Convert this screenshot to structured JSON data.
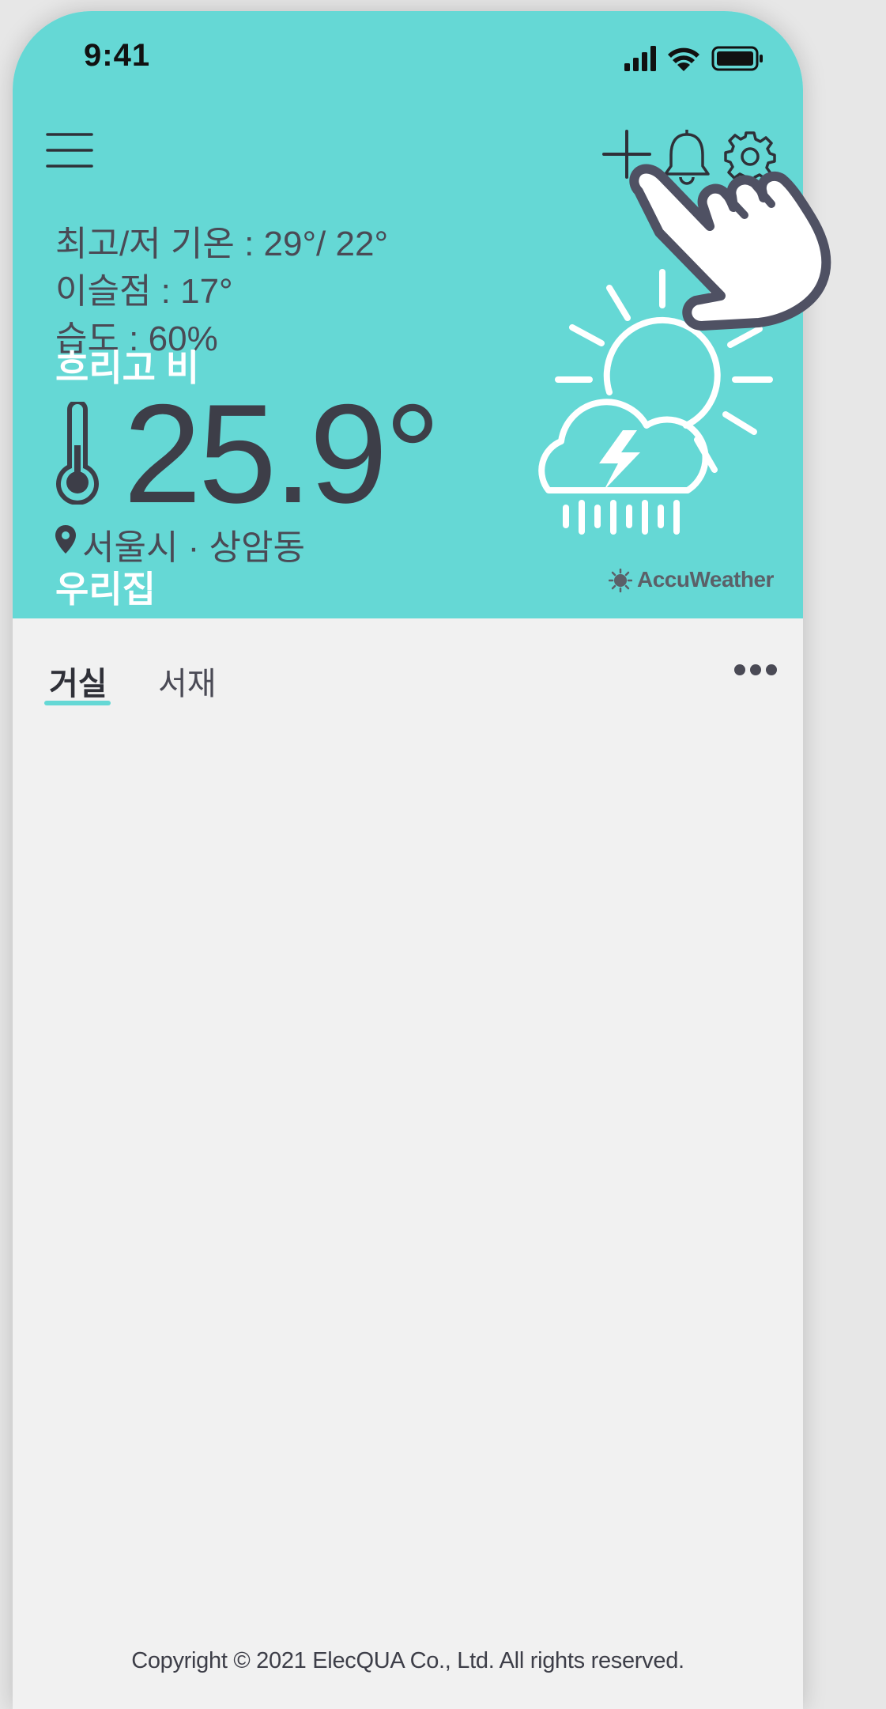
{
  "status_bar": {
    "time": "9:41"
  },
  "weather": {
    "high_low": "최고/저 기온 : 29°/ 22°",
    "dew_point": "이슬점 : 17°",
    "humidity": "습도 : 60%",
    "condition": "흐리고 비",
    "temperature": "25.9°",
    "location": "서울시 · 상암동",
    "place_name": "우리집",
    "provider": "AccuWeather"
  },
  "tabs": [
    {
      "label": "거실",
      "active": true
    },
    {
      "label": "서재",
      "active": false
    }
  ],
  "footer": {
    "copyright": "Copyright © 2021 ElecQUA Co., Ltd. All rights reserved."
  },
  "colors": {
    "header": "#65d8d5",
    "background": "#f1f1f1",
    "text_dark": "#3d3e48",
    "accent": "#65d8d5"
  },
  "icons": [
    "menu-icon",
    "plus-icon",
    "bell-icon",
    "gear-icon",
    "thermometer-icon",
    "location-pin-icon",
    "weather-sun-cloud-rain-icon",
    "more-dots-icon",
    "pointing-hand-icon"
  ]
}
